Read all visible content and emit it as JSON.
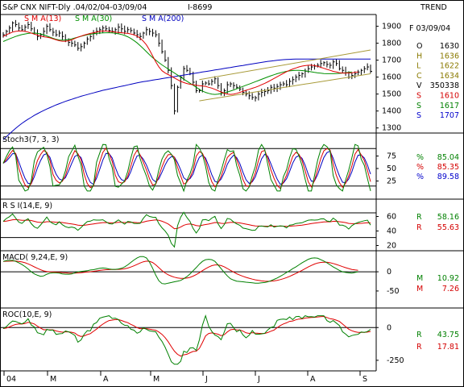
{
  "header": {
    "title": "S&P CNX NIFT-Dly .04/02/04-03/09/04",
    "code": "I-8699",
    "panel": "TREND"
  },
  "ohlc": {
    "date": "F 03/09/04",
    "rows": [
      {
        "key": "O",
        "value": "1630",
        "color": "#000000"
      },
      {
        "key": "H",
        "value": "1636",
        "color": "#8a7a00"
      },
      {
        "key": "L",
        "value": "1622",
        "color": "#8a7a00"
      },
      {
        "key": "C",
        "value": "1634",
        "color": "#8a7a00"
      },
      {
        "key": "V",
        "value": "350338",
        "color": "#000000"
      },
      {
        "key": "S",
        "value": "1610",
        "color": "#d40000"
      },
      {
        "key": "S",
        "value": "1617",
        "color": "#008000"
      },
      {
        "key": "S",
        "value": "1707",
        "color": "#0000cc"
      }
    ]
  },
  "colors": {
    "price": "#000000",
    "sma13": "#e00000",
    "sma30": "#009000",
    "sma200": "#0000c0",
    "channel": "#a89a38",
    "stoch_k": "#008000",
    "stoch_d": "#e00000",
    "stoch_s": "#0000c0"
  },
  "chart_data": [
    {
      "type": "line",
      "name": "price",
      "x_labels": [
        "04",
        "M",
        "A",
        "M",
        "J",
        "J",
        "A",
        "S"
      ],
      "y_ticks": [
        "1900",
        "1800",
        "1700",
        "1600",
        "1500",
        "1400",
        "1300"
      ],
      "ylim": [
        1270,
        1960
      ],
      "legend": [
        "S M A(13)",
        "S M A(30)",
        "S M A(200)"
      ],
      "close": [
        1850,
        1870,
        1890,
        1920,
        1910,
        1890,
        1880,
        1895,
        1910,
        1885,
        1860,
        1840,
        1850,
        1870,
        1900,
        1880,
        1865,
        1850,
        1860,
        1840,
        1820,
        1805,
        1800,
        1790,
        1770,
        1780,
        1800,
        1825,
        1840,
        1860,
        1870,
        1880,
        1890,
        1885,
        1875,
        1870,
        1880,
        1895,
        1885,
        1870,
        1880,
        1875,
        1860,
        1850,
        1840,
        1860,
        1880,
        1870,
        1860,
        1850,
        1800,
        1750,
        1700,
        1640,
        1550,
        1400,
        1540,
        1600,
        1650,
        1640,
        1620,
        1570,
        1520,
        1520,
        1560,
        1565,
        1560,
        1575,
        1590,
        1550,
        1510,
        1520,
        1555,
        1560,
        1550,
        1540,
        1530,
        1510,
        1500,
        1490,
        1480,
        1478,
        1500,
        1510,
        1515,
        1520,
        1540,
        1535,
        1545,
        1555,
        1560,
        1555,
        1575,
        1585,
        1600,
        1610,
        1620,
        1635,
        1650,
        1660,
        1665,
        1670,
        1680,
        1685,
        1675,
        1670,
        1690,
        1680,
        1650,
        1640,
        1625,
        1600,
        1610,
        1620,
        1630,
        1640,
        1650,
        1660,
        1634
      ],
      "sma13": [
        1840,
        1850,
        1858,
        1866,
        1870,
        1872,
        1872,
        1870,
        1866,
        1860,
        1854,
        1848,
        1842,
        1838,
        1836,
        1832,
        1826,
        1820,
        1815,
        1812,
        1812,
        1815,
        1820,
        1828,
        1836,
        1842,
        1848,
        1853,
        1858,
        1862,
        1866,
        1870,
        1872,
        1872,
        1870,
        1868,
        1866,
        1864,
        1862,
        1860,
        1858,
        1855,
        1850,
        1842,
        1830,
        1812,
        1790,
        1760,
        1725,
        1690,
        1660,
        1638,
        1625,
        1615,
        1605,
        1595,
        1585,
        1575,
        1568,
        1562,
        1558,
        1555,
        1552,
        1550,
        1548,
        1545,
        1540,
        1535,
        1528,
        1520,
        1512,
        1505,
        1500,
        1498,
        1500,
        1504,
        1510,
        1516,
        1522,
        1528,
        1534,
        1540,
        1547,
        1555,
        1563,
        1572,
        1582,
        1592,
        1602,
        1612,
        1622,
        1632,
        1640,
        1648,
        1654,
        1660,
        1665,
        1668,
        1670,
        1670,
        1668,
        1664,
        1658,
        1652,
        1646,
        1640,
        1634,
        1630,
        1626,
        1624,
        1624,
        1625,
        1626,
        1628,
        1630
      ],
      "sma30": [
        1810,
        1818,
        1826,
        1833,
        1840,
        1846,
        1851,
        1855,
        1858,
        1860,
        1860,
        1858,
        1855,
        1850,
        1843,
        1836,
        1829,
        1823,
        1819,
        1818,
        1819,
        1822,
        1826,
        1831,
        1836,
        1841,
        1846,
        1850,
        1853,
        1856,
        1858,
        1860,
        1861,
        1862,
        1862,
        1861,
        1859,
        1856,
        1852,
        1846,
        1838,
        1828,
        1816,
        1802,
        1786,
        1768,
        1750,
        1732,
        1715,
        1700,
        1686,
        1672,
        1660,
        1648,
        1636,
        1624,
        1612,
        1600,
        1588,
        1576,
        1564,
        1552,
        1540,
        1528,
        1518,
        1510,
        1504,
        1500,
        1498,
        1500,
        1503,
        1507,
        1512,
        1518,
        1524,
        1531,
        1538,
        1545,
        1552,
        1559,
        1566,
        1573,
        1580,
        1587,
        1594,
        1601,
        1608,
        1614,
        1620,
        1625,
        1630,
        1634,
        1637,
        1639,
        1640,
        1640,
        1639,
        1637,
        1634,
        1631,
        1628,
        1625,
        1623,
        1621,
        1620,
        1620,
        1620,
        1621,
        1622,
        1624,
        1626,
        1628,
        1630
      ],
      "sma200": [
        1230,
        1248,
        1265,
        1282,
        1298,
        1313,
        1327,
        1340,
        1352,
        1363,
        1374,
        1384,
        1394,
        1403,
        1412,
        1420,
        1428,
        1436,
        1443,
        1450,
        1457,
        1463,
        1469,
        1475,
        1481,
        1487,
        1492,
        1497,
        1502,
        1507,
        1512,
        1517,
        1522,
        1526,
        1530,
        1534,
        1538,
        1542,
        1546,
        1550,
        1554,
        1558,
        1562,
        1566,
        1570,
        1573,
        1576,
        1579,
        1582,
        1585,
        1588,
        1591,
        1594,
        1597,
        1600,
        1603,
        1606,
        1609,
        1612,
        1615,
        1618,
        1621,
        1624,
        1627,
        1630,
        1633,
        1636,
        1639,
        1642,
        1645,
        1648,
        1651,
        1654,
        1657,
        1660,
        1663,
        1666,
        1669,
        1672,
        1675,
        1678,
        1681,
        1684,
        1687,
        1690,
        1693,
        1695,
        1697,
        1699,
        1701,
        1703,
        1704,
        1705,
        1706,
        1707,
        1707,
        1707,
        1707,
        1707,
        1707,
        1707,
        1707,
        1707,
        1707,
        1707,
        1707,
        1707,
        1707,
        1707,
        1707,
        1707,
        1707,
        1707,
        1707,
        1707,
        1707,
        1707,
        1707,
        1707
      ],
      "channel_upper": {
        "from": [
          1540,
          1585
        ],
        "to": [
          1760,
          1730
        ]
      },
      "channel_lower": {
        "from": [
          1460,
          1505
        ],
        "to": [
          1620,
          1630
        ]
      }
    },
    {
      "type": "line",
      "name": "Stoch3(7, 3, 3)",
      "y_ticks": [
        "75",
        "50",
        "25"
      ],
      "ylim": [
        0,
        100
      ],
      "readouts": [
        {
          "key": "%",
          "value": "85.04",
          "color": "#008000"
        },
        {
          "key": "%",
          "value": "85.35",
          "color": "#d40000"
        },
        {
          "key": "%",
          "value": "89.58",
          "color": "#0000cc"
        }
      ]
    },
    {
      "type": "line",
      "name": "R S I(14,E, 9)",
      "y_ticks": [
        "60",
        "40",
        "20"
      ],
      "ylim": [
        15,
        75
      ],
      "readouts": [
        {
          "key": "R",
          "value": "58.16",
          "color": "#008000"
        },
        {
          "key": "R",
          "value": "55.63",
          "color": "#d40000"
        }
      ]
    },
    {
      "type": "line",
      "name": "MACD( 9,24,E, 9)",
      "y_ticks": [
        "0",
        "-50"
      ],
      "ylim": [
        -90,
        40
      ],
      "readouts": [
        {
          "key": "M",
          "value": "10.92",
          "color": "#008000"
        },
        {
          "key": "M",
          "value": "7.26",
          "color": "#d40000"
        }
      ]
    },
    {
      "type": "line",
      "name": "ROC(10,E, 9)",
      "y_ticks": [
        "0",
        "-250"
      ],
      "ylim": [
        -300,
        100
      ],
      "readouts": [
        {
          "key": "R",
          "value": "43.75",
          "color": "#008000"
        },
        {
          "key": "R",
          "value": "17.81",
          "color": "#d40000"
        }
      ]
    }
  ]
}
